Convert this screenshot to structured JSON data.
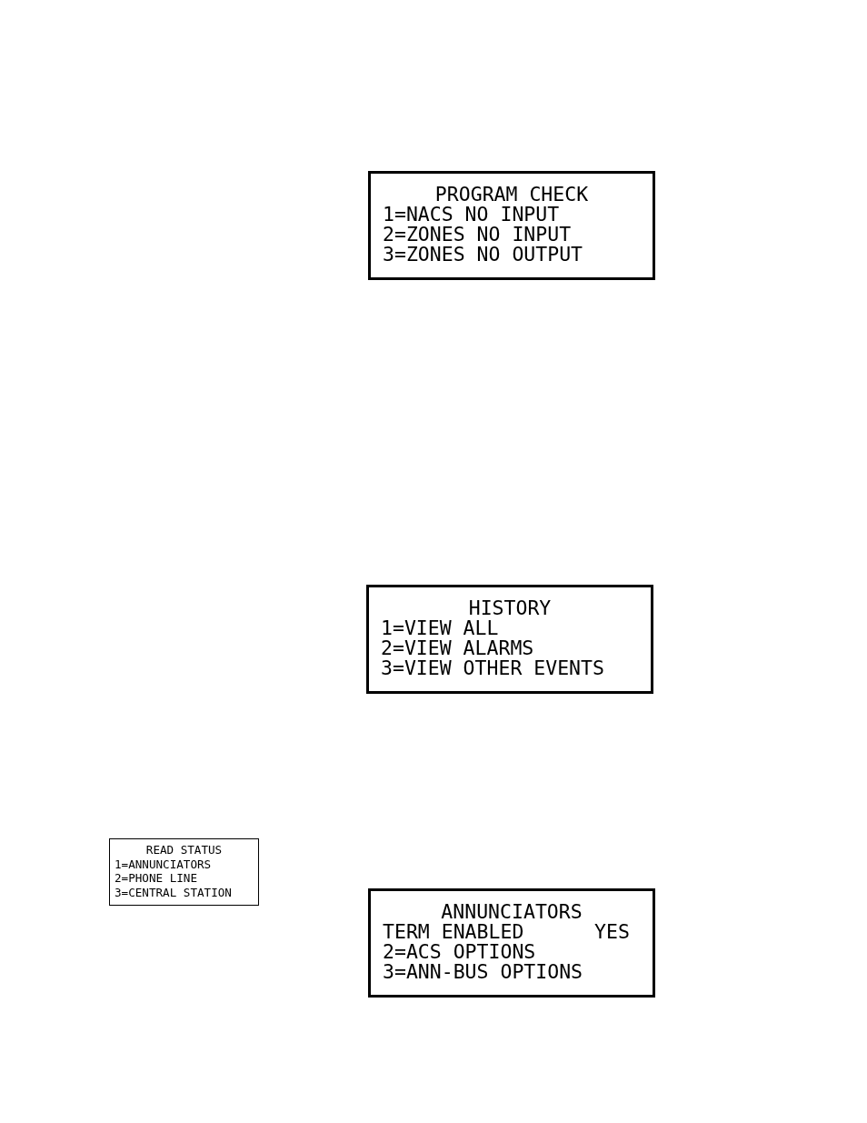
{
  "displays": [
    {
      "kind": "large",
      "title": "PROGRAM CHECK",
      "lines": [
        "1=NACS NO INPUT",
        "2=ZONES NO INPUT",
        "3=ZONES NO OUTPUT"
      ]
    },
    {
      "kind": "large",
      "title": "HISTORY",
      "lines": [
        "1=VIEW ALL",
        "2=VIEW ALARMS",
        "3=VIEW OTHER EVENTS"
      ]
    },
    {
      "kind": "small",
      "title": "READ STATUS",
      "lines": [
        "1=ANNUNCIATORS",
        "2=PHONE LINE",
        "3=CENTRAL STATION"
      ]
    },
    {
      "kind": "large",
      "title": "ANNUNCIATORS",
      "lines": [
        "TERM ENABLED      YES",
        "2=ACS OPTIONS",
        "3=ANN-BUS OPTIONS"
      ]
    }
  ]
}
